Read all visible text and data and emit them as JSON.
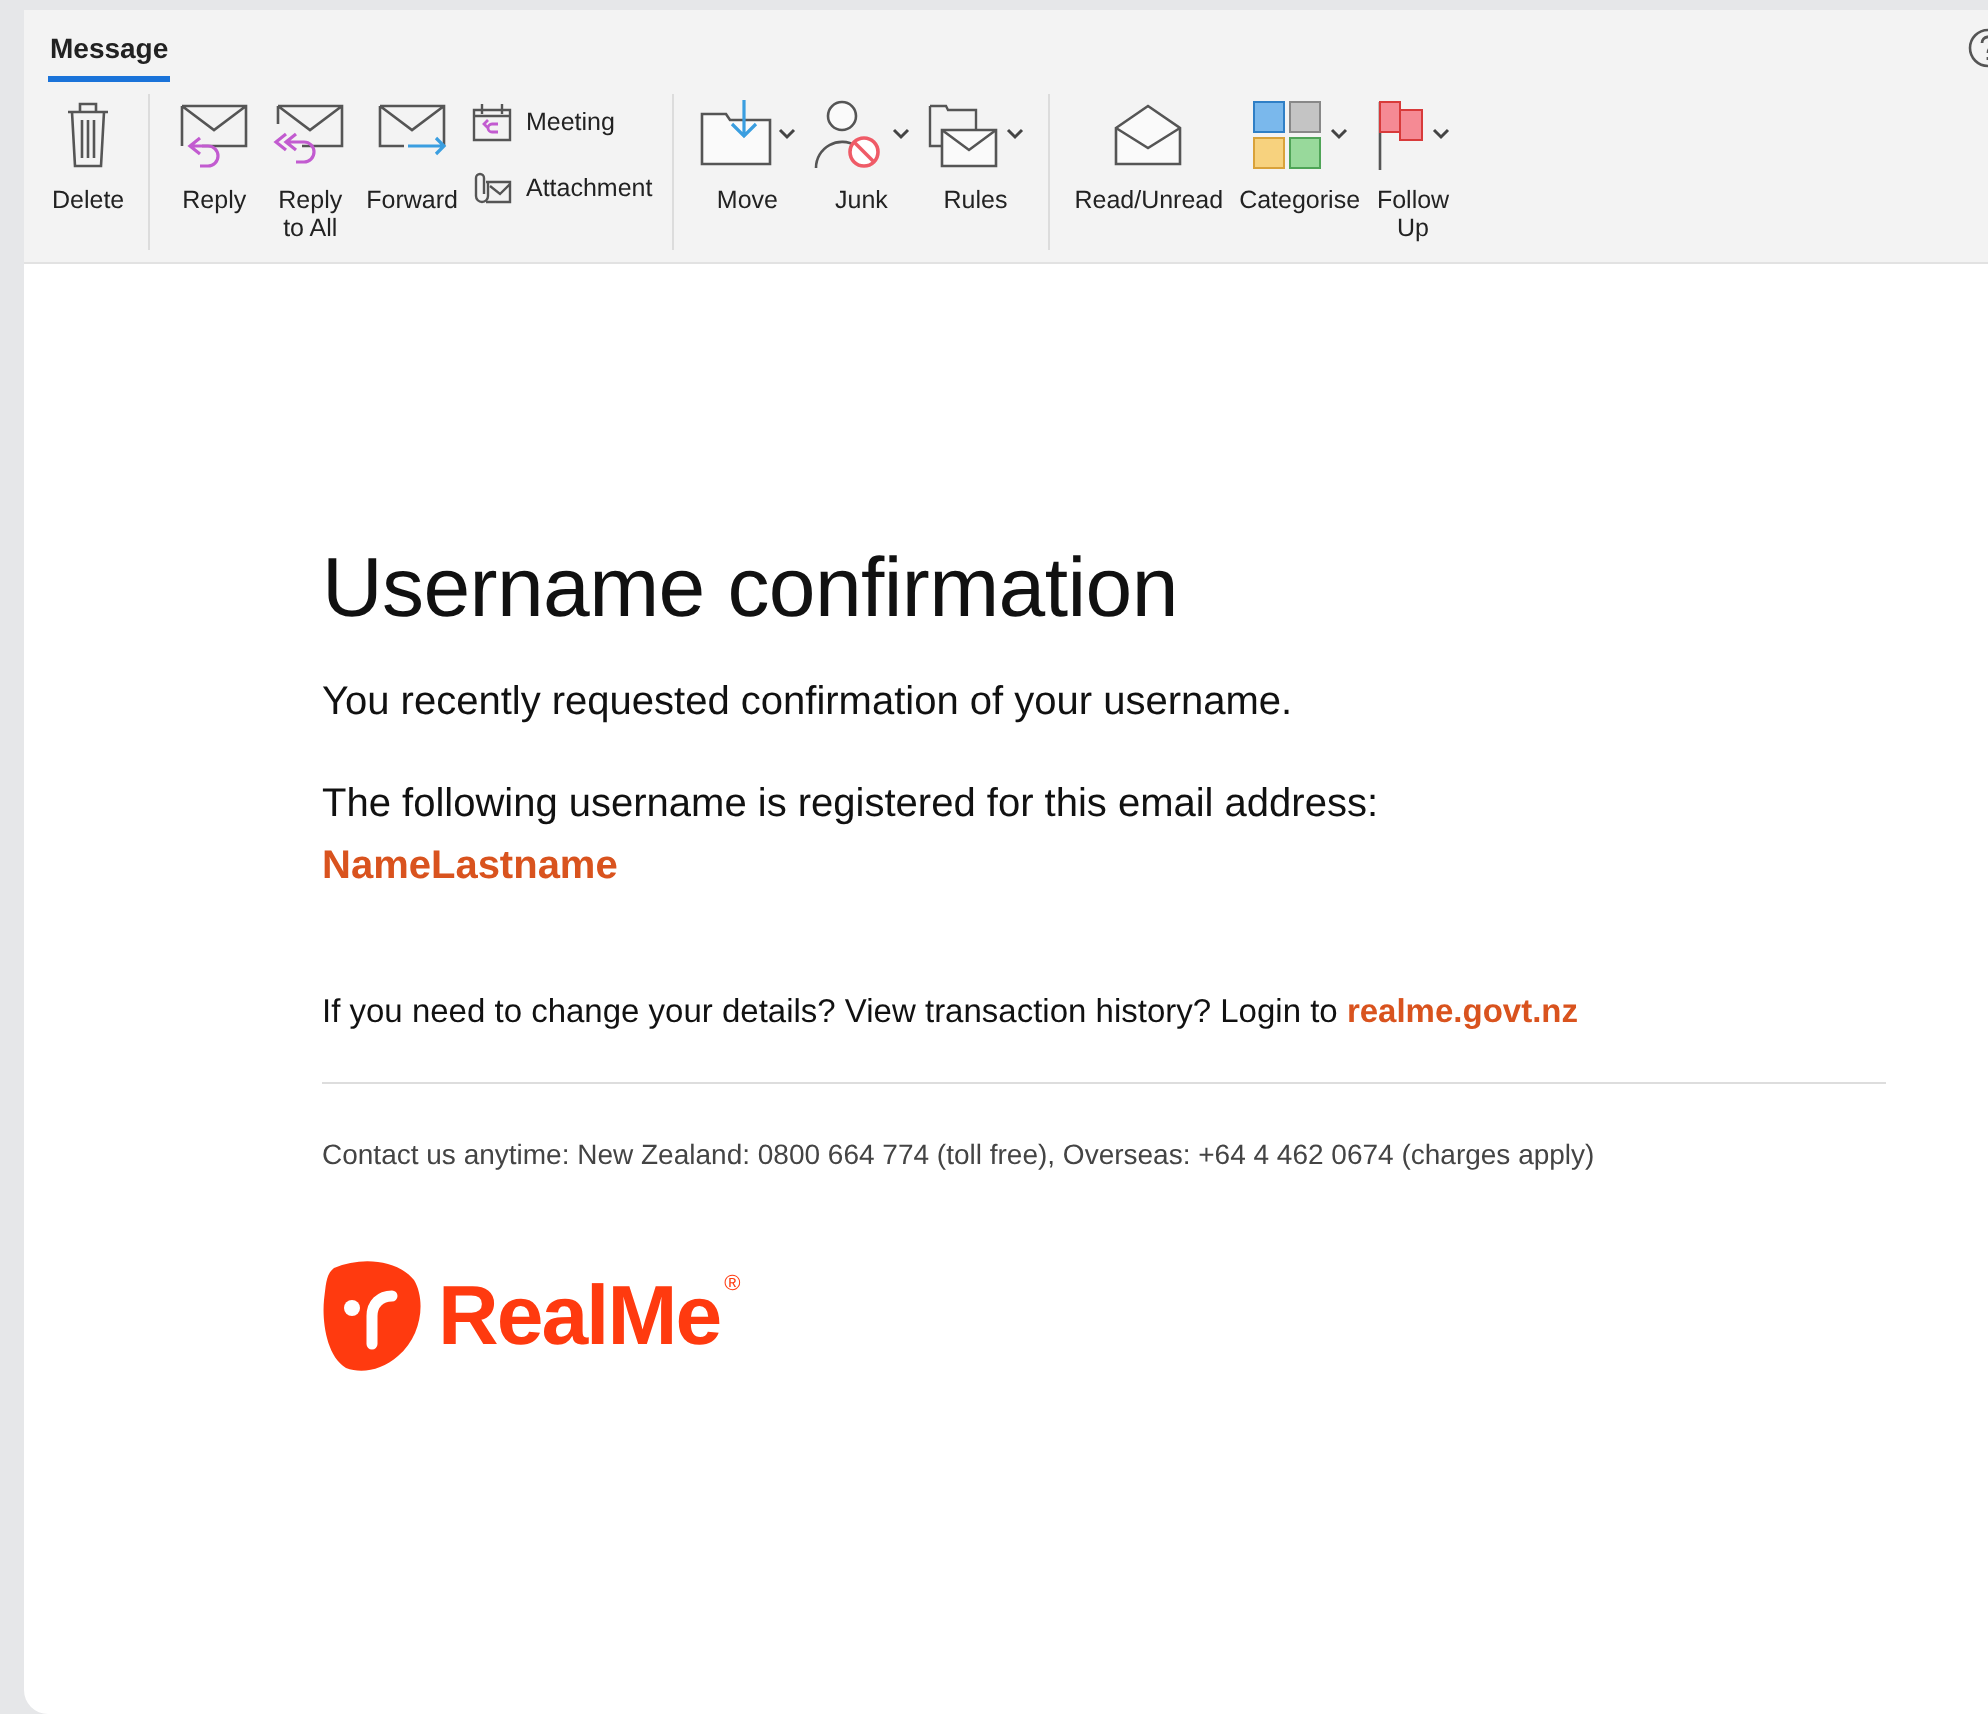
{
  "ribbon": {
    "tabs": [
      {
        "label": "Message",
        "selected": true
      }
    ],
    "groups": [
      [
        {
          "label": "Delete",
          "kind": "large",
          "dropdown": false
        }
      ],
      [
        {
          "label": "Reply",
          "kind": "large",
          "dropdown": false
        },
        {
          "label": "Reply\nto All",
          "kind": "large",
          "dropdown": false
        },
        {
          "label": "Forward",
          "kind": "large",
          "dropdown": false
        },
        {
          "label": "Meeting",
          "kind": "small",
          "dropdown": false
        },
        {
          "label": "Attachment",
          "kind": "small",
          "dropdown": false
        }
      ],
      [
        {
          "label": "Move",
          "kind": "large",
          "dropdown": true
        },
        {
          "label": "Junk",
          "kind": "large",
          "dropdown": true
        },
        {
          "label": "Rules",
          "kind": "large",
          "dropdown": true
        }
      ],
      [
        {
          "label": "Read/Unread",
          "kind": "large",
          "dropdown": false
        },
        {
          "label": "Categorise",
          "kind": "large",
          "dropdown": true
        },
        {
          "label": "Follow\nUp",
          "kind": "large",
          "dropdown": true
        }
      ]
    ]
  },
  "email": {
    "heading": "Username confirmation",
    "intro": "You recently requested confirmation of your username.",
    "registered": "The following username is registered for this email address:",
    "username": "NameLastname",
    "details": "If you need to change your details? View transaction history? Login to",
    "details_link": "realme.govt.nz",
    "contact": "Contact us anytime: New Zealand: 0800 664 774 (toll free), Overseas: +64 4 462 0674 (charges apply)",
    "brand": "RealMe",
    "brand_mark": "®"
  }
}
